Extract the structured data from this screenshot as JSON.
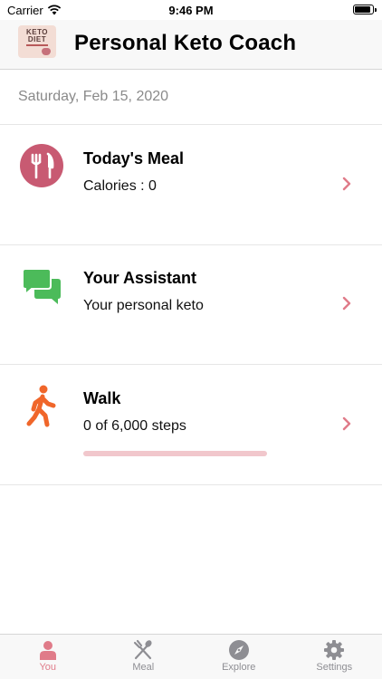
{
  "status": {
    "carrier": "Carrier",
    "time": "9:46 PM"
  },
  "header": {
    "title": "Personal Keto Coach",
    "logo_line1": "KETO",
    "logo_line2": "DIET"
  },
  "date": "Saturday, Feb 15, 2020",
  "cards": [
    {
      "title": "Today's Meal",
      "subtitle": "Calories : 0",
      "icon": "fork-knife-icon",
      "icon_color": "#c85a72"
    },
    {
      "title": "Your Assistant",
      "subtitle": "Your personal keto",
      "icon": "chat-bubbles-icon",
      "icon_color": "#4cbb5a"
    },
    {
      "title": "Walk",
      "subtitle": "0 of 6,000 steps",
      "icon": "walking-person-icon",
      "icon_color": "#f0662a",
      "progress": 0
    }
  ],
  "tabs": [
    {
      "label": "You",
      "icon": "person-icon",
      "active": true
    },
    {
      "label": "Meal",
      "icon": "fork-spoon-icon",
      "active": false
    },
    {
      "label": "Explore",
      "icon": "compass-icon",
      "active": false
    },
    {
      "label": "Settings",
      "icon": "gear-icon",
      "active": false
    }
  ],
  "colors": {
    "accent": "#e07b89",
    "inactive": "#8e8e93",
    "date_text": "#8a8a8a"
  }
}
